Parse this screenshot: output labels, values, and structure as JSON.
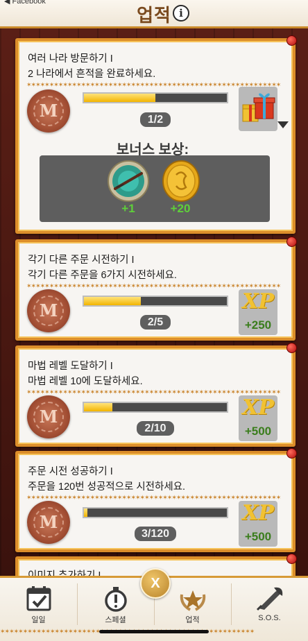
{
  "header": {
    "back_label": "◀ Facebook",
    "title": "업적",
    "info_glyph": "i"
  },
  "stars": "✶✶✶✶✶✶✶✶✶✶✶✶✶✶✶✶✶✶✶✶✶✶✶✶✶✶✶✶✶✶✶✶✶✶✶✶✶✶✶✶✶✶✶✶✶✶✶✶✶✶✶✶✶✶✶✶",
  "achievements": [
    {
      "title": "여러 나라 방문하기 I",
      "desc": "2 나라에서 흔적을 완료하세요.",
      "progress_text": "1/2",
      "progress": 0.5,
      "reward_icon": "gift-box-icon",
      "bonus_title": "보너스 보상:",
      "bonus_items": [
        {
          "icon": "compass-medal-icon",
          "value": "+1"
        },
        {
          "icon": "gold-coin-icon",
          "value": "+20"
        }
      ]
    },
    {
      "title": "각기 다른 주문 시전하기 I",
      "desc": "각기 다른 주문을 6가지 시전하세요.",
      "progress_text": "2/5",
      "progress": 0.4,
      "xp_label": "XP",
      "xp_amount": "+250"
    },
    {
      "title": "마법 레벨 도달하기 I",
      "desc": "마법 레벨 10에 도달하세요.",
      "progress_text": "2/10",
      "progress": 0.2,
      "xp_label": "XP",
      "xp_amount": "+500"
    },
    {
      "title": "주문 시전 성공하기 I",
      "desc": "주문을 120번 성공적으로 시전하세요.",
      "progress_text": "3/120",
      "progress": 0.025,
      "xp_label": "XP",
      "xp_amount": "+500"
    },
    {
      "title": "이미지 추가하기 I"
    }
  ],
  "seal_letter": "M",
  "close_label": "X",
  "tabs": [
    {
      "label": "일일",
      "icon": "calendar-check-icon"
    },
    {
      "label": "스페셜",
      "icon": "stopwatch-icon"
    },
    {
      "label": "업적",
      "icon": "star-laurel-icon"
    },
    {
      "label": "S.O.S.",
      "icon": "scroll-quill-icon"
    }
  ]
}
